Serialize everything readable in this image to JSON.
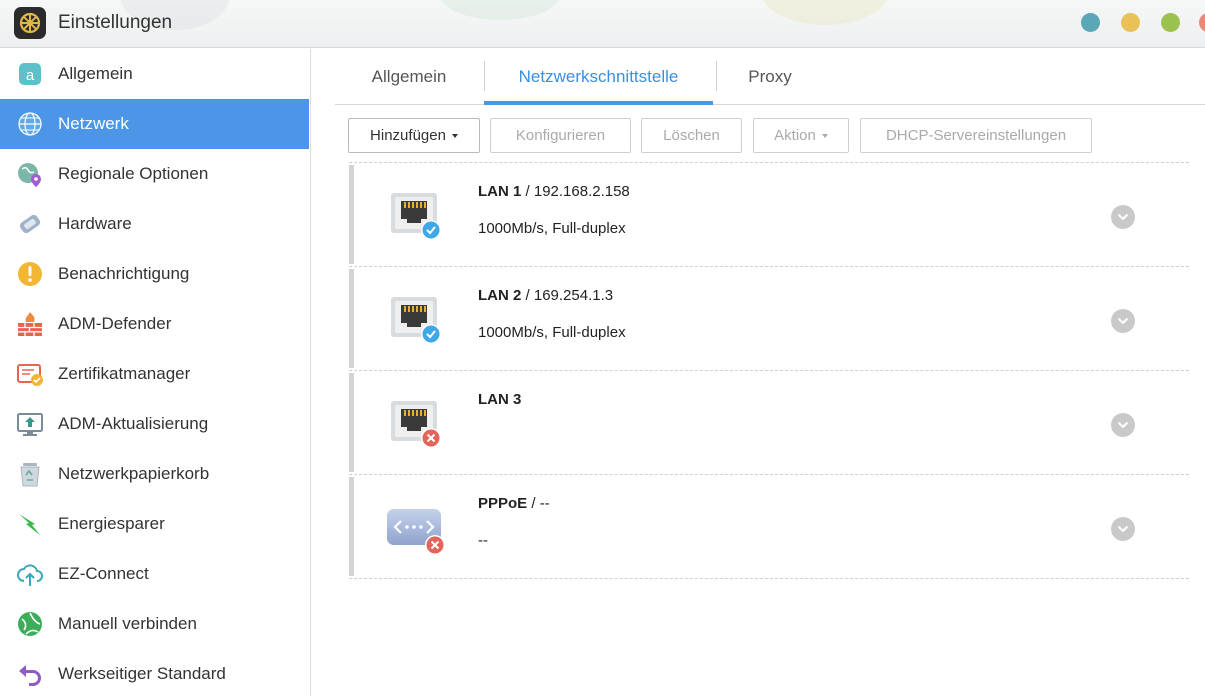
{
  "window": {
    "title": "Einstellungen",
    "controls": [
      {
        "name": "minimize",
        "color": "#5ba7b8"
      },
      {
        "name": "maximize",
        "color": "#e9c156"
      },
      {
        "name": "restore",
        "color": "#9bc24e"
      },
      {
        "name": "close",
        "color": "#e9897a"
      }
    ]
  },
  "sidebar": {
    "items": [
      {
        "label": "Allgemein",
        "icon": "general-icon"
      },
      {
        "label": "Netzwerk",
        "icon": "globe-icon",
        "active": true
      },
      {
        "label": "Regionale Optionen",
        "icon": "region-icon"
      },
      {
        "label": "Hardware",
        "icon": "hardware-icon"
      },
      {
        "label": "Benachrichtigung",
        "icon": "notification-icon"
      },
      {
        "label": "ADM-Defender",
        "icon": "firewall-icon"
      },
      {
        "label": "Zertifikatmanager",
        "icon": "certificate-icon"
      },
      {
        "label": "ADM-Aktualisierung",
        "icon": "update-icon"
      },
      {
        "label": "Netzwerkpapierkorb",
        "icon": "recycle-bin-icon"
      },
      {
        "label": "Energiesparer",
        "icon": "energy-icon"
      },
      {
        "label": "EZ-Connect",
        "icon": "cloud-upload-icon"
      },
      {
        "label": "Manuell verbinden",
        "icon": "connect-icon"
      },
      {
        "label": "Werkseitiger Standard",
        "icon": "reset-icon"
      }
    ]
  },
  "tabs": [
    {
      "label": "Allgemein"
    },
    {
      "label": "Netzwerkschnittstelle",
      "active": true
    },
    {
      "label": "Proxy"
    }
  ],
  "toolbar": {
    "add": "Hinzufügen",
    "configure": "Konfigurieren",
    "delete": "Löschen",
    "action": "Aktion",
    "dhcp": "DHCP-Servereinstellungen"
  },
  "interfaces": [
    {
      "name": "LAN 1",
      "address": " / 192.168.2.158",
      "detail": "1000Mb/s, Full-duplex",
      "status": "connected",
      "type": "ethernet"
    },
    {
      "name": "LAN 2",
      "address": " / 169.254.1.3",
      "detail": "1000Mb/s, Full-duplex",
      "status": "connected",
      "type": "ethernet"
    },
    {
      "name": "LAN 3",
      "address": "",
      "detail": "",
      "status": "disconnected",
      "type": "ethernet"
    },
    {
      "name": "PPPoE",
      "address": " / --",
      "detail": "--",
      "status": "disconnected",
      "type": "pppoe"
    }
  ],
  "colors": {
    "accent": "#4d95e6",
    "connected": "#3fa9e8",
    "disconnected": "#e2645a"
  }
}
